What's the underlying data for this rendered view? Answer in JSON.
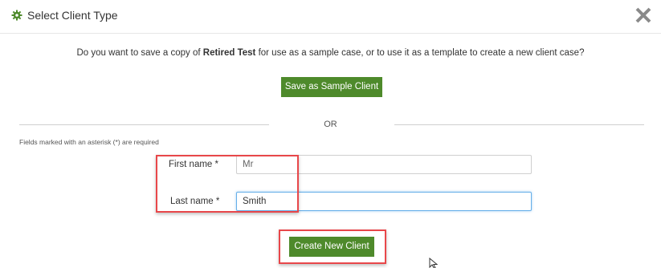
{
  "dialog": {
    "title": "Select Client Type",
    "header_icon": "gear-icon",
    "close_icon": "close-icon"
  },
  "prompt": {
    "before": "Do you want to save a copy of ",
    "case_name": "Retired Test",
    "after": " for use as a sample case, or to use it as a template to create a new client case?"
  },
  "buttons": {
    "save_sample": "Save as Sample Client",
    "create_client": "Create New Client"
  },
  "divider_text": "OR",
  "required_note": "Fields marked with an asterisk (*) are required",
  "form": {
    "first_name_label": "First name *",
    "first_name_placeholder": "Mr",
    "first_name_value": "",
    "last_name_label": "Last name *",
    "last_name_value": "Smith"
  },
  "colors": {
    "accent_green": "#4e8a2b",
    "highlight_red": "#e8474a",
    "focus_blue": "#66afe9"
  }
}
